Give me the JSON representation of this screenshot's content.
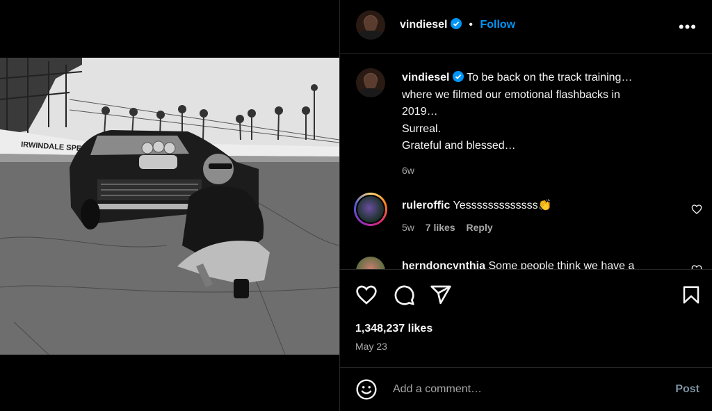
{
  "post": {
    "username": "vindiesel",
    "follow_label": "Follow",
    "dot": "•",
    "more": "•••",
    "photo_sign_text": "IRWINDALE SPEEDWAY"
  },
  "caption": {
    "username": "vindiesel",
    "lines": [
      "To be back on the track training…",
      "where we filmed our emotional flashbacks in",
      "2019…",
      "Surreal.",
      "Grateful and blessed…"
    ],
    "age": "6w"
  },
  "comments": [
    {
      "username": "ruleroffic",
      "text": "Yesssssssssssss👏",
      "age": "5w",
      "likes": "7 likes",
      "reply": "Reply"
    },
    {
      "username": "herndoncynthia",
      "text": "Some people think we have a"
    }
  ],
  "stats": {
    "likes": "1,348,237 likes",
    "date": "May 23"
  },
  "composer": {
    "placeholder": "Add a comment…",
    "post": "Post"
  },
  "colors": {
    "accent": "#0095f6",
    "background": "#000000",
    "muted": "#a8a8a8",
    "divider": "#262626"
  }
}
